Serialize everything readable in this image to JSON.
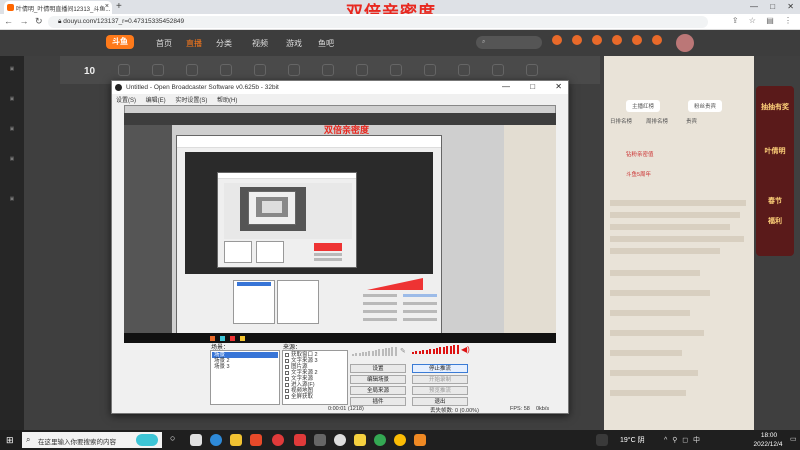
{
  "browser": {
    "tab_title": "叶倩明_叶倩明直播间12313_斗鱼...",
    "new_tab": "+",
    "url": "douyu.com/123137_r=0.47315335452849",
    "window_controls": [
      "—",
      "□",
      "✕"
    ]
  },
  "overlay_title": "双倍亲密度",
  "douyu": {
    "logo": "斗鱼",
    "nav": [
      "首页",
      "直播",
      "分类",
      "视频",
      "游戏",
      "鱼吧"
    ],
    "room_level": "10",
    "right_panel": {
      "btn1": "主播红榜",
      "btn2": "粉丝贵宾",
      "tab1": "日排名榜",
      "tab2": "周排名榜",
      "tab3": "贵宾",
      "row1": "钻粉亲密值",
      "row2": "斗鱼5周年"
    },
    "promo": [
      "抽抽有奖",
      "叶倩明",
      "春节",
      "福利"
    ]
  },
  "obs": {
    "title": "Untitled - Open Broadcaster Software v0.625b - 32bit",
    "menu": [
      "设置(S)",
      "编辑(E)",
      "实时设置(S)",
      "帮助(H)"
    ],
    "overlay_title": "双倍亲密度",
    "scenes_label": "场景：",
    "sources_label": "来源：",
    "scenes": [
      "场景",
      "场景 2",
      "场景 3"
    ],
    "sources": [
      "获取窗口 2",
      "文字来源 3",
      "图片源",
      "文字来源 2",
      "文字来源",
      "进入源(F)",
      "视频地图",
      "全屏获取"
    ],
    "buttons": {
      "settings": "设置",
      "stop_stream": "停止推流",
      "edit_scene": "编辑场景",
      "start_record": "开始录制",
      "global_sources": "全局来源",
      "preview": "预览推流",
      "plugins": "插件",
      "exit": "退出"
    },
    "status": {
      "dropped": "0:00:01 (1218)",
      "frames": "丢失帧数: 0 (0.00%)",
      "fps": "FPS: 58",
      "kbps": "0kb/s"
    }
  },
  "taskbar": {
    "search_placeholder": "在这里输入你要搜索的内容",
    "weather": "19°C 阴",
    "tray": "^ ⚲ ◻ 中",
    "time": "18:00",
    "date": "2022/12/4"
  },
  "colors": {
    "accent_red": "#e8281f",
    "douyu_orange": "#ff7a1a",
    "obs_selection": "#3875d7"
  }
}
